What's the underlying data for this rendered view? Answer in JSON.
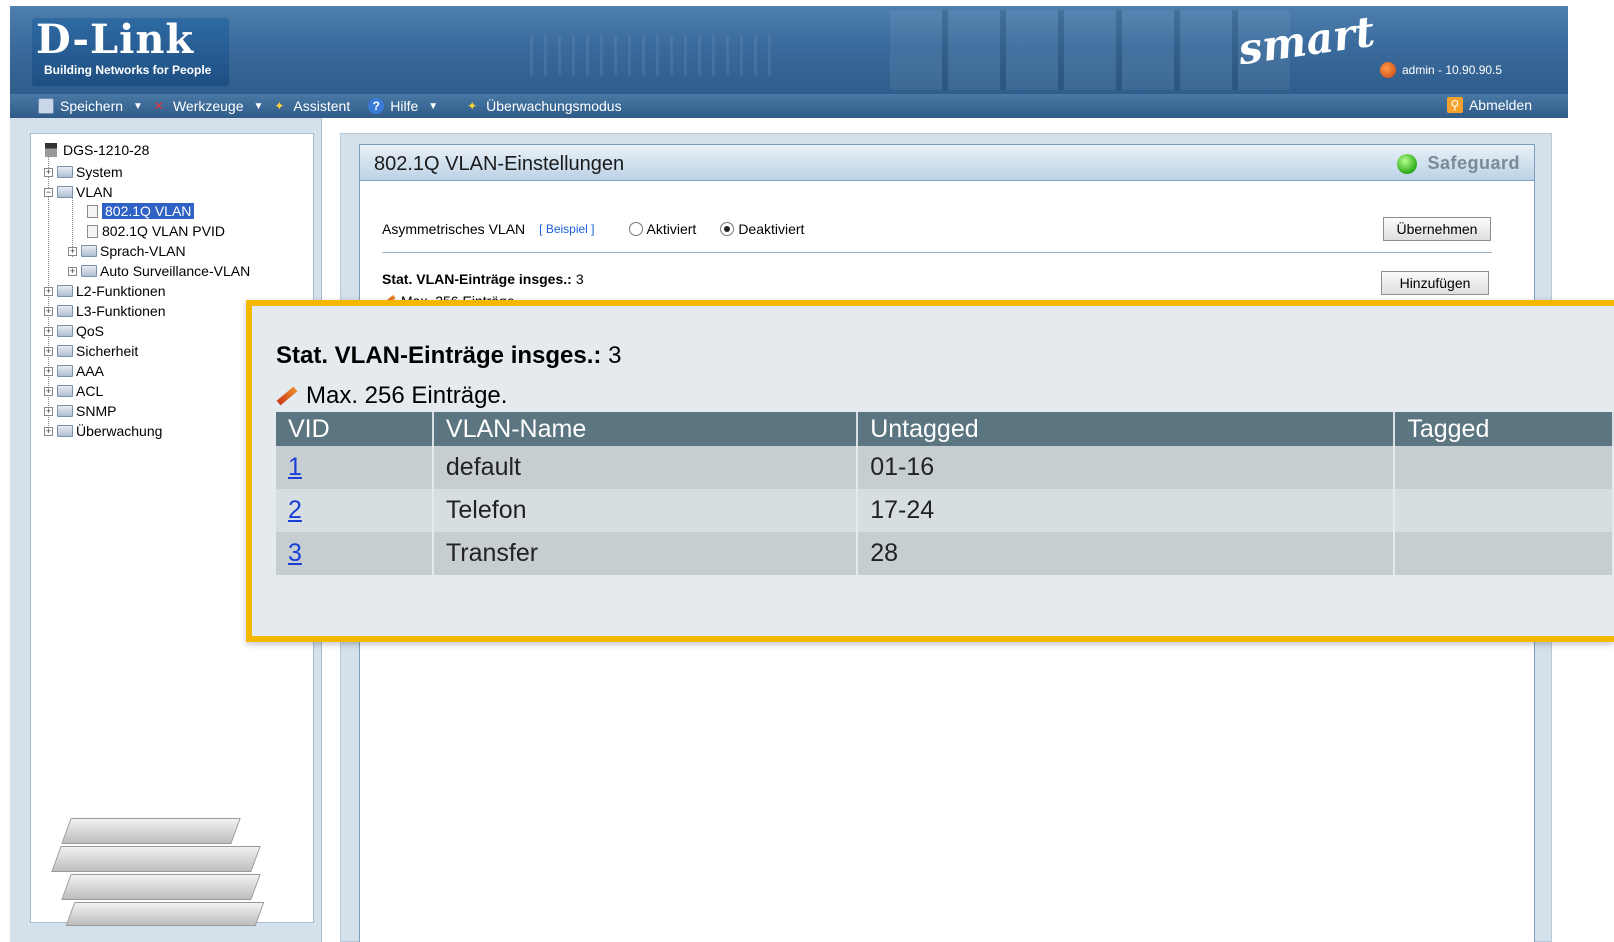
{
  "header": {
    "brand": "D-Link",
    "tagline": "Building Networks for People",
    "product_logo": "smart",
    "user": "admin - 10.90.90.5"
  },
  "menu": {
    "items": [
      {
        "label": "Speichern",
        "icon": "save-icon",
        "dropdown": true
      },
      {
        "label": "Werkzeuge",
        "icon": "tools-icon",
        "dropdown": true
      },
      {
        "label": "Assistent",
        "icon": "wizard-icon",
        "dropdown": false
      },
      {
        "label": "Hilfe",
        "icon": "help-icon",
        "dropdown": true
      },
      {
        "label": "Überwachungsmodus",
        "icon": "wizard-icon",
        "dropdown": false
      }
    ],
    "logout": "Abmelden"
  },
  "tree": {
    "root": "DGS-1210-28",
    "items": [
      {
        "label": "System"
      },
      {
        "label": "VLAN"
      },
      {
        "label": "802.1Q VLAN"
      },
      {
        "label": "802.1Q VLAN PVID"
      },
      {
        "label": "Sprach-VLAN"
      },
      {
        "label": "Auto Surveillance-VLAN"
      },
      {
        "label": "L2-Funktionen"
      },
      {
        "label": "L3-Funktionen"
      },
      {
        "label": "QoS"
      },
      {
        "label": "Sicherheit"
      },
      {
        "label": "AAA"
      },
      {
        "label": "ACL"
      },
      {
        "label": "SNMP"
      },
      {
        "label": "Überwachung"
      }
    ]
  },
  "main": {
    "title": "802.1Q VLAN-Einstellungen",
    "safeguard": "Safeguard",
    "asym_label": "Asymmetrisches VLAN",
    "example_link": "[ Beispiel ]",
    "radio_enabled": "Aktiviert",
    "radio_disabled": "Deaktiviert",
    "selected_radio": "Deaktiviert",
    "apply_button": "Übernehmen",
    "total_label": "Stat. VLAN-Einträge insges.:",
    "total_value": "3",
    "max_note": "Max. 256 Einträge.",
    "add_button": "Hinzufügen"
  },
  "zoom": {
    "total_label": "Stat. VLAN-Einträge insges.:",
    "total_value": "3",
    "max_note": "Max. 256 Einträge.",
    "columns": [
      "VID",
      "VLAN-Name",
      "Untagged",
      "Tagged"
    ],
    "rows": [
      {
        "vid": "1",
        "name": "default",
        "untagged": "01-16",
        "tagged": ""
      },
      {
        "vid": "2",
        "name": "Telefon",
        "untagged": "17-24",
        "tagged": ""
      },
      {
        "vid": "3",
        "name": "Transfer",
        "untagged": "28",
        "tagged": ""
      }
    ]
  },
  "colors": {
    "banner": "#3a6b9c",
    "zoom_border": "#f5b800",
    "table_header": "#5b7681",
    "link": "#1a3fd8"
  }
}
